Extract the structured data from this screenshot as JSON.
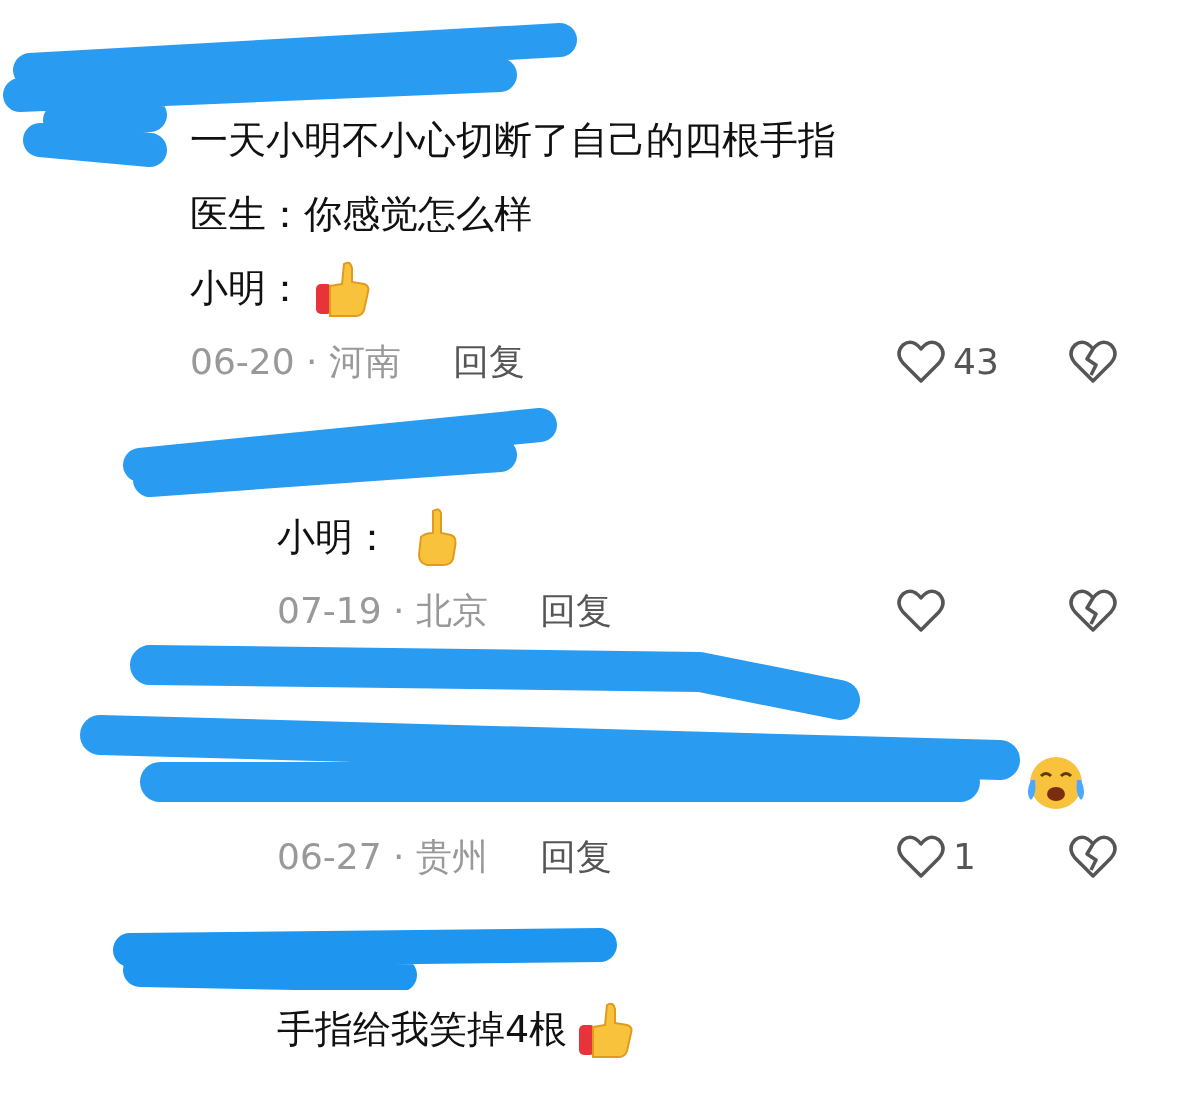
{
  "comments": [
    {
      "lines": [
        "一天小明不小心切断了自己的四根手指",
        "医生：你感觉怎么样",
        "小明："
      ],
      "meta": "06-20 · 河南",
      "reply_label": "回复",
      "likes": "43"
    },
    {
      "lines": [
        "小明："
      ],
      "meta": "07-19 · 北京",
      "reply_label": "回复"
    },
    {
      "meta": "06-27 · 贵州",
      "reply_label": "回复",
      "likes": "1"
    },
    {
      "lines": [
        "手指给我笑掉4根"
      ]
    }
  ]
}
